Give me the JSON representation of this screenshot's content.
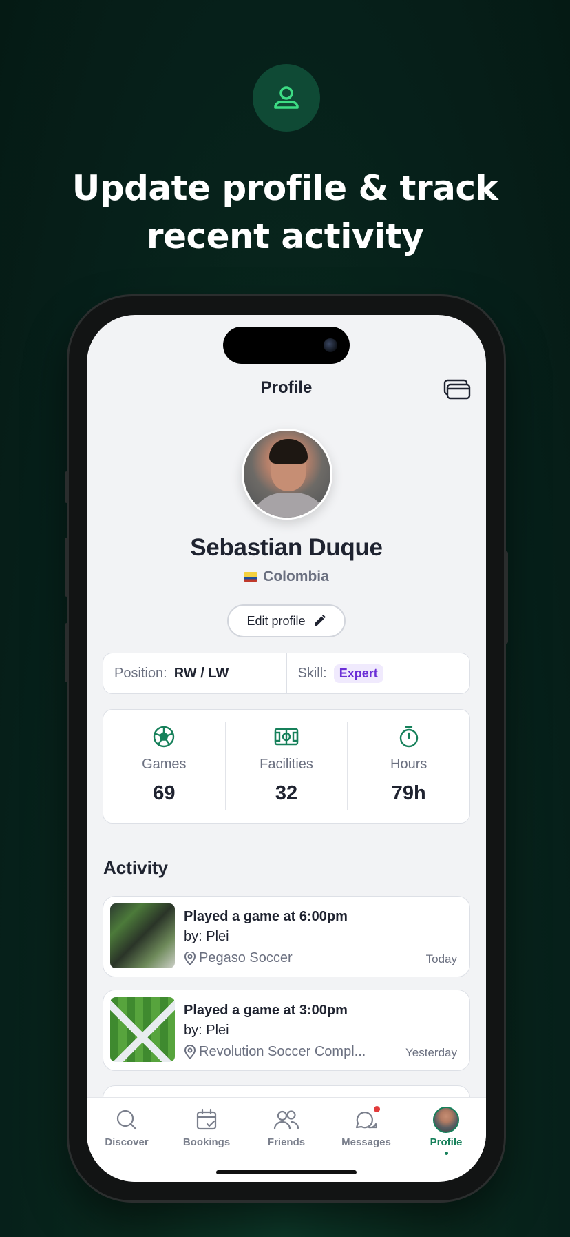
{
  "promo": {
    "icon": "user-icon",
    "headline_line1": "Update profile & track",
    "headline_line2": "recent activity"
  },
  "header": {
    "title": "Profile",
    "wallet_icon": "wallet-cards-icon"
  },
  "profile": {
    "name": "Sebastian Duque",
    "country": "Colombia",
    "edit_label": "Edit profile",
    "position_label": "Position:",
    "position_value": "RW / LW",
    "skill_label": "Skill:",
    "skill_value": "Expert"
  },
  "stats": [
    {
      "icon": "soccer-ball-icon",
      "label": "Games",
      "value": "69"
    },
    {
      "icon": "field-icon",
      "label": "Facilities",
      "value": "32"
    },
    {
      "icon": "stopwatch-icon",
      "label": "Hours",
      "value": "79h"
    }
  ],
  "activity": {
    "title": "Activity",
    "items": [
      {
        "title": "Played a game at 6:00pm",
        "by": "by: Plei",
        "place": "Pegaso Soccer",
        "when": "Today"
      },
      {
        "title": "Played a game at 3:00pm",
        "by": "by: Plei",
        "place": "Revolution Soccer Compl...",
        "when": "Yesterday"
      }
    ]
  },
  "tabs": [
    {
      "label": "Discover",
      "icon": "search-icon",
      "active": false
    },
    {
      "label": "Bookings",
      "icon": "calendar-check-icon",
      "active": false
    },
    {
      "label": "Friends",
      "icon": "friends-icon",
      "active": false
    },
    {
      "label": "Messages",
      "icon": "messages-icon",
      "active": false
    },
    {
      "label": "Profile",
      "icon": "avatar",
      "active": true
    }
  ],
  "colors": {
    "background": "#06201a",
    "accent": "#16805a",
    "skill_badge": "#6b2fd6",
    "notification": "#e23b3b"
  }
}
